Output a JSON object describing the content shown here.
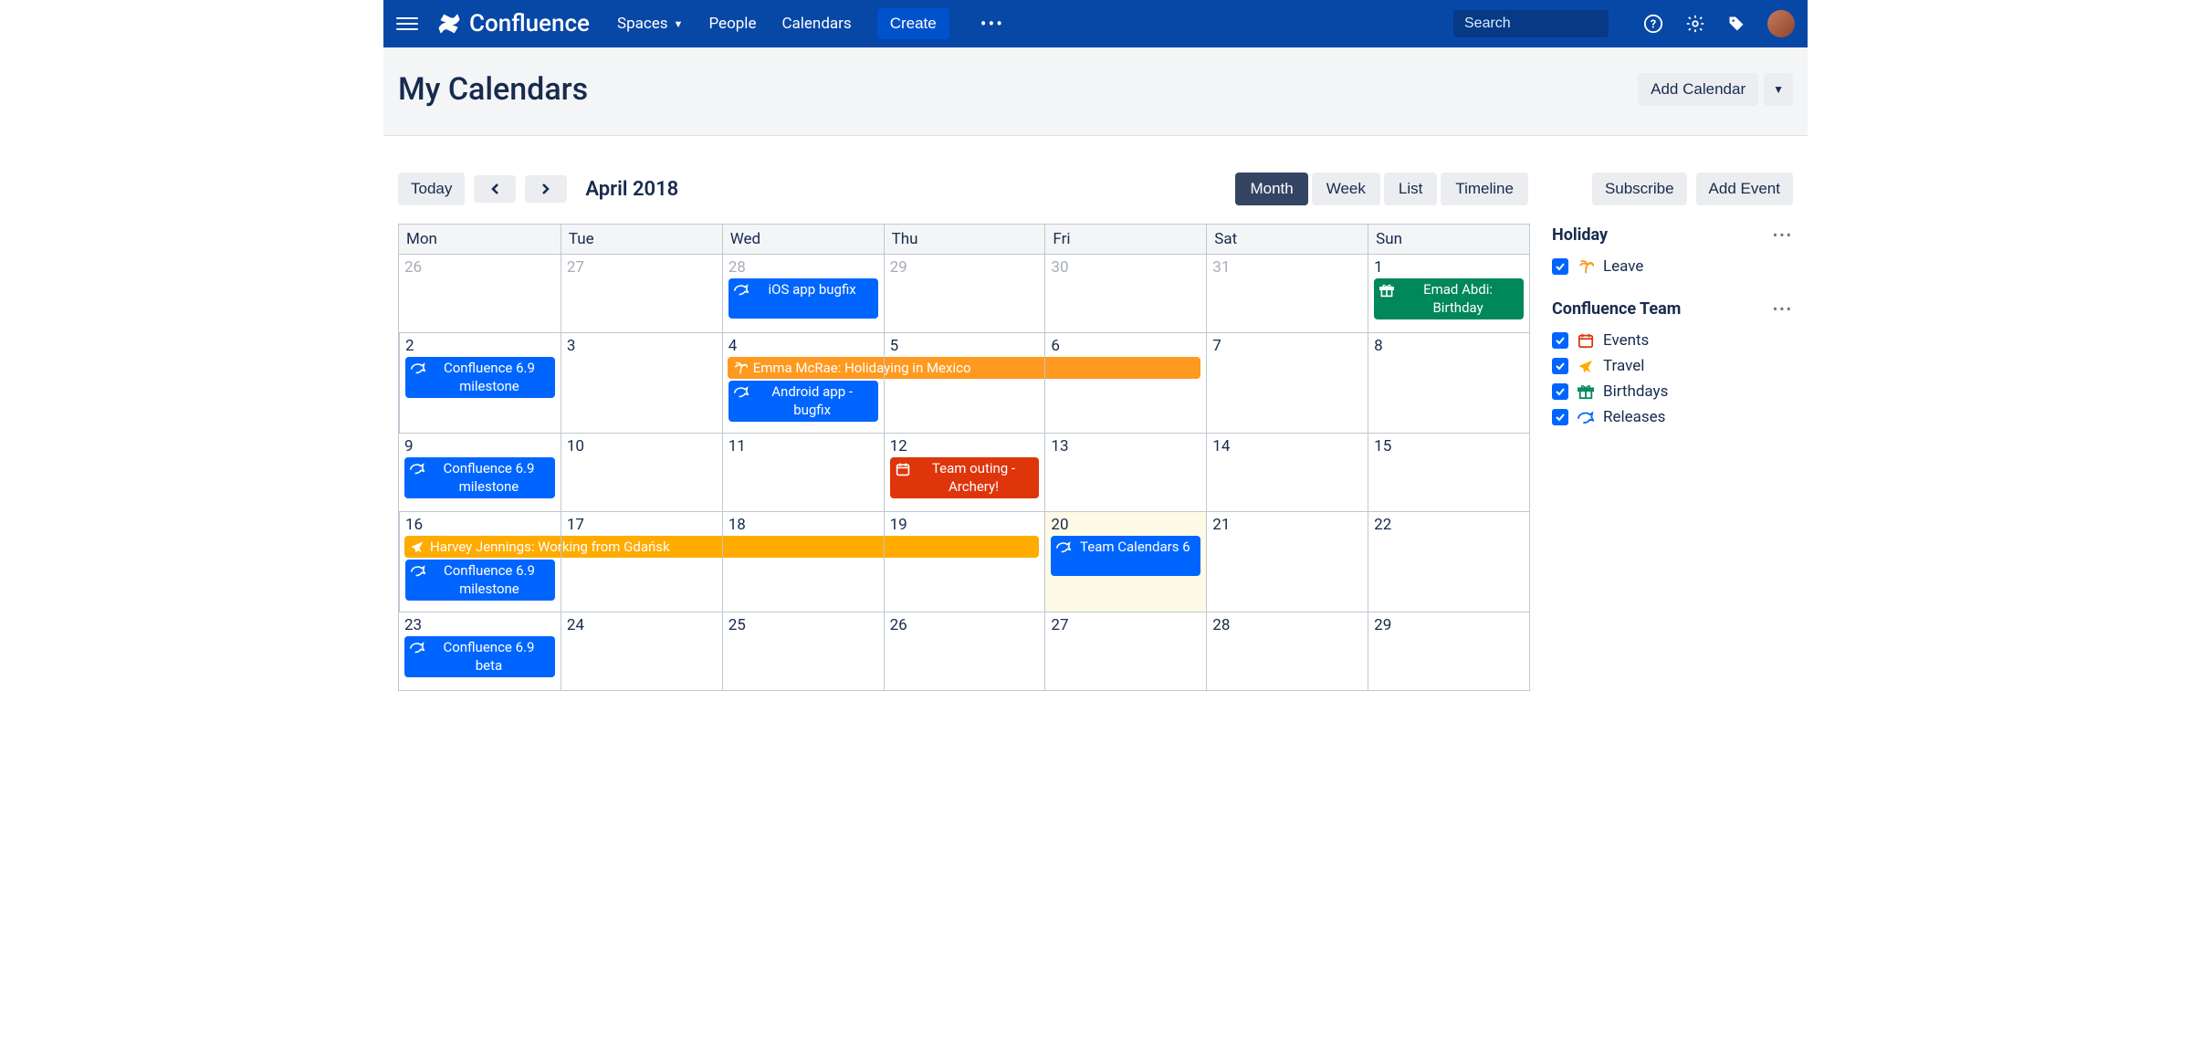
{
  "nav": {
    "brand": "Confluence",
    "links": {
      "spaces": "Spaces",
      "people": "People",
      "calendars": "Calendars"
    },
    "create": "Create",
    "search_placeholder": "Search"
  },
  "page": {
    "title": "My Calendars",
    "add_calendar": "Add Calendar"
  },
  "toolbar": {
    "today": "Today",
    "month_label": "April 2018",
    "views": {
      "month": "Month",
      "week": "Week",
      "list": "List",
      "timeline": "Timeline"
    },
    "subscribe": "Subscribe",
    "add_event": "Add Event"
  },
  "days": {
    "mon": "Mon",
    "tue": "Tue",
    "wed": "Wed",
    "thu": "Thu",
    "fri": "Fri",
    "sat": "Sat",
    "sun": "Sun"
  },
  "weeks": [
    {
      "nums": [
        "26",
        "27",
        "28",
        "29",
        "30",
        "31",
        "1"
      ],
      "muted": [
        0,
        1,
        2,
        3,
        4,
        5
      ],
      "today": null
    },
    {
      "nums": [
        "2",
        "3",
        "4",
        "5",
        "6",
        "7",
        "8"
      ],
      "muted": [],
      "today": null
    },
    {
      "nums": [
        "9",
        "10",
        "11",
        "12",
        "13",
        "14",
        "15"
      ],
      "muted": [],
      "today": null
    },
    {
      "nums": [
        "16",
        "17",
        "18",
        "19",
        "20",
        "21",
        "22"
      ],
      "muted": [],
      "today": 4
    },
    {
      "nums": [
        "23",
        "24",
        "25",
        "26",
        "27",
        "28",
        "29"
      ],
      "muted": [],
      "today": null
    }
  ],
  "events": {
    "w0_wed": "iOS app bugfix",
    "w0_sun": "Emad Abdi: Birthday",
    "w1_mon": "Confluence 6.9 milestone",
    "w1_span": "Emma McRae: Holidaying in Mexico",
    "w1_wed": "Android app - bugfix",
    "w2_mon": "Confluence 6.9 milestone",
    "w2_thu": "Team outing - Archery!",
    "w3_span": "Harvey Jennings: Working from Gdańsk",
    "w3_mon": "Confluence 6.9 milestone",
    "w3_fri": "Team Calendars 6",
    "w4_mon": "Confluence 6.9 beta"
  },
  "sidebar": {
    "holiday": {
      "title": "Holiday",
      "leave": "Leave"
    },
    "team": {
      "title": "Confluence Team",
      "events": "Events",
      "travel": "Travel",
      "birthdays": "Birthdays",
      "releases": "Releases"
    }
  },
  "colors": {
    "release": "#0065ff",
    "birthday": "#00875a",
    "leave": "#ff991f",
    "event": "#de350b",
    "travel": "#ffab00"
  }
}
